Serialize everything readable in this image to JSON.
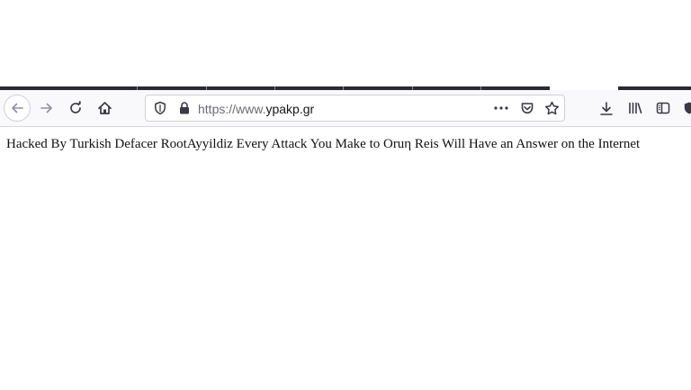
{
  "browser": {
    "address_bar": {
      "scheme_prefix": "https://www.",
      "domain": "ypakp.gr"
    },
    "toolbar_icons": [
      "back-arrow-icon",
      "forward-arrow-icon",
      "reload-icon",
      "home-icon",
      "shield-icon",
      "lock-icon",
      "more-dots-icon",
      "pocket-icon",
      "bookmark-star-icon",
      "download-icon",
      "library-icon",
      "sidebar-icon",
      "extension-shield-icon"
    ]
  },
  "page": {
    "body_text": "Hacked By Turkish Defacer RootAyyildiz Every Attack You Make to Oruη Reis Will Have an Answer on the Internet"
  },
  "colors": {
    "tab_strip": "#2b2a33",
    "toolbar_bg": "#f9f9fb",
    "icon": "#3a3944"
  }
}
